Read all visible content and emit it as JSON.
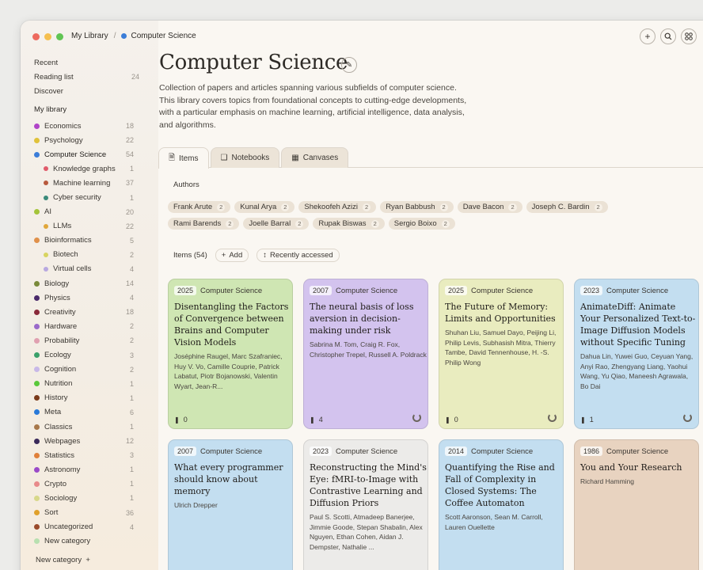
{
  "colors": {
    "accent": "#3b7dd8"
  },
  "breadcrumb": {
    "root": "My Library",
    "separator": "/",
    "current": "Computer Science"
  },
  "nav": [
    {
      "label": "Recent",
      "count": ""
    },
    {
      "label": "Reading list",
      "count": "24"
    },
    {
      "label": "Discover",
      "count": ""
    }
  ],
  "library": {
    "title": "My library",
    "items": [
      {
        "label": "Economics",
        "count": "18",
        "color": "#b044c8",
        "sub": false
      },
      {
        "label": "Psychology",
        "count": "22",
        "color": "#e0c23a",
        "sub": false
      },
      {
        "label": "Computer Science",
        "count": "54",
        "color": "#3b7dd8",
        "sub": false,
        "active": true
      },
      {
        "label": "Knowledge graphs",
        "count": "1",
        "color": "#e05a6a",
        "sub": true
      },
      {
        "label": "Machine learning",
        "count": "37",
        "color": "#b85a3e",
        "sub": true
      },
      {
        "label": "Cyber security",
        "count": "1",
        "color": "#3a8a7a",
        "sub": true
      },
      {
        "label": "AI",
        "count": "20",
        "color": "#a4c43a",
        "sub": false
      },
      {
        "label": "LLMs",
        "count": "22",
        "color": "#e0a63a",
        "sub": true
      },
      {
        "label": "Bioinformatics",
        "count": "5",
        "color": "#e0904a",
        "sub": false
      },
      {
        "label": "Biotech",
        "count": "2",
        "color": "#d8d460",
        "sub": true
      },
      {
        "label": "Virtual cells",
        "count": "4",
        "color": "#b8a8e0",
        "sub": true
      },
      {
        "label": "Biology",
        "count": "14",
        "color": "#7a8a3a",
        "sub": false
      },
      {
        "label": "Physics",
        "count": "4",
        "color": "#4a2a6a",
        "sub": false
      },
      {
        "label": "Creativity",
        "count": "18",
        "color": "#8a2a3a",
        "sub": false
      },
      {
        "label": "Hardware",
        "count": "2",
        "color": "#9a6aca",
        "sub": false
      },
      {
        "label": "Probability",
        "count": "2",
        "color": "#e0a0b0",
        "sub": false
      },
      {
        "label": "Ecology",
        "count": "3",
        "color": "#3aa06a",
        "sub": false
      },
      {
        "label": "Cognition",
        "count": "2",
        "color": "#c8b8e8",
        "sub": false
      },
      {
        "label": "Nutrition",
        "count": "1",
        "color": "#5ac83a",
        "sub": false
      },
      {
        "label": "History",
        "count": "1",
        "color": "#7a3a1a",
        "sub": false
      },
      {
        "label": "Meta",
        "count": "6",
        "color": "#2a7ad8",
        "sub": false
      },
      {
        "label": "Classics",
        "count": "1",
        "color": "#a8784a",
        "sub": false
      },
      {
        "label": "Webpages",
        "count": "12",
        "color": "#3a2a5a",
        "sub": false
      },
      {
        "label": "Statistics",
        "count": "3",
        "color": "#e0803a",
        "sub": false
      },
      {
        "label": "Astronomy",
        "count": "1",
        "color": "#9a4ac8",
        "sub": false
      },
      {
        "label": "Crypto",
        "count": "1",
        "color": "#e88a8a",
        "sub": false
      },
      {
        "label": "Sociology",
        "count": "1",
        "color": "#d8d88a",
        "sub": false
      },
      {
        "label": "Sort",
        "count": "36",
        "color": "#e0a02a",
        "sub": false
      },
      {
        "label": "Uncategorized",
        "count": "4",
        "color": "#9a4a2a",
        "sub": false
      },
      {
        "label": "New category",
        "count": "",
        "color": "#b8e0b0",
        "sub": false
      }
    ]
  },
  "footer_new_category": "New category",
  "page": {
    "title": "Computer Science",
    "description": "Collection of papers and articles spanning various subfields of computer science. This library covers topics from foundational concepts to cutting-edge developments, with a particular emphasis on machine learning, artificial intelligence, data analysis, and algorithms."
  },
  "tabs": [
    {
      "label": "Items",
      "icon": "document-icon",
      "active": true
    },
    {
      "label": "Notebooks",
      "icon": "notebook-icon",
      "active": false
    },
    {
      "label": "Canvases",
      "icon": "grid-icon",
      "active": false
    }
  ],
  "authors": {
    "label": "Authors",
    "chips": [
      {
        "name": "Frank Arute",
        "count": "2"
      },
      {
        "name": "Kunal Arya",
        "count": "2"
      },
      {
        "name": "Shekoofeh Azizi",
        "count": "2"
      },
      {
        "name": "Ryan Babbush",
        "count": "2"
      },
      {
        "name": "Dave Bacon",
        "count": "2"
      },
      {
        "name": "Joseph C. Bardin",
        "count": "2"
      },
      {
        "name": "Rami Barends",
        "count": "2"
      },
      {
        "name": "Joelle Barral",
        "count": "2"
      },
      {
        "name": "Rupak Biswas",
        "count": "2"
      },
      {
        "name": "Sergio Boixo",
        "count": "2"
      }
    ]
  },
  "items_bar": {
    "count_label": "Items (54)",
    "add_label": "Add",
    "sort_label": "Recently accessed"
  },
  "cards": [
    {
      "year": "2025",
      "category": "Computer Science",
      "title": "Disentangling the Factors of Convergence between Brains and Computer Vision Models",
      "authors": "Joséphine Raugel, Marc Szafraniec, Huy V. Vo, Camille Couprie, Patrick Labatut, Piotr Bojanowski, Valentin Wyart, Jean-R...",
      "notes": "0",
      "color": "#cfe6b3",
      "spinner": false
    },
    {
      "year": "2007",
      "category": "Computer Science",
      "title": "The neural basis of loss aversion in decision-making under risk",
      "authors": "Sabrina M. Tom, Craig R. Fox, Christopher Trepel, Russell A. Poldrack",
      "notes": "4",
      "color": "#d3c3ee",
      "spinner": true
    },
    {
      "year": "2025",
      "category": "Computer Science",
      "title": "The Future of Memory: Limits and Opportunities",
      "authors": "Shuhan Liu, Samuel Dayo, Peijing Li, Philip Levis, Subhasish Mitra, Thierry Tambe, David Tennenhouse, H. -S. Philip Wong",
      "notes": "0",
      "color": "#e9ecbf",
      "spinner": true
    },
    {
      "year": "2023",
      "category": "Computer Science",
      "title": "AnimateDiff: Animate Your Personalized Text-to-Image Diffusion Models without Specific Tuning",
      "authors": "Dahua Lin, Yuwei Guo, Ceyuan Yang, Anyi Rao, Zhengyang Liang, Yaohui Wang, Yu Qiao, Maneesh Agrawala, Bo Dai",
      "notes": "1",
      "color": "#c3def0",
      "spinner": true
    },
    {
      "year": "2007",
      "category": "Computer Science",
      "title": "What every programmer should know about memory",
      "authors": "Ulrich Drepper",
      "notes": "",
      "color": "#c3def0",
      "spinner": false
    },
    {
      "year": "2023",
      "category": "Computer Science",
      "title": "Reconstructing the Mind's Eye: fMRI-to-Image with Contrastive Learning and Diffusion Priors",
      "authors": "Paul S. Scotti, Atmadeep Banerjee, Jimmie Goode, Stepan Shabalin, Alex Nguyen, Ethan Cohen, Aidan J. Dempster, Nathalie ...",
      "notes": "",
      "color": "#ecebe9",
      "spinner": false
    },
    {
      "year": "2014",
      "category": "Computer Science",
      "title": "Quantifying the Rise and Fall of Complexity in Closed Systems: The Coffee Automaton",
      "authors": "Scott Aaronson, Sean M. Carroll, Lauren Ouellette",
      "notes": "",
      "color": "#c3def0",
      "spinner": false
    },
    {
      "year": "1986",
      "category": "Computer Science",
      "title": "You and Your Research",
      "authors": "Richard Hamming",
      "notes": "",
      "color": "#e8d3c0",
      "spinner": false
    }
  ]
}
